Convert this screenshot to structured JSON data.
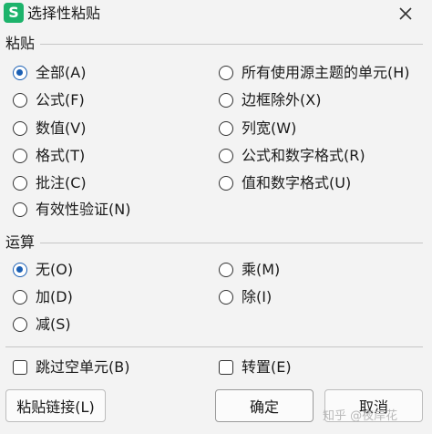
{
  "window": {
    "app_icon_letter": "S",
    "title": "选择性粘贴",
    "close_icon": "close-icon"
  },
  "paste": {
    "label": "粘贴",
    "options": [
      {
        "label": "全部(A)",
        "selected": true
      },
      {
        "label": "所有使用源主题的单元(H)",
        "selected": false
      },
      {
        "label": "公式(F)",
        "selected": false
      },
      {
        "label": "边框除外(X)",
        "selected": false
      },
      {
        "label": "数值(V)",
        "selected": false
      },
      {
        "label": "列宽(W)",
        "selected": false
      },
      {
        "label": "格式(T)",
        "selected": false
      },
      {
        "label": "公式和数字格式(R)",
        "selected": false
      },
      {
        "label": "批注(C)",
        "selected": false
      },
      {
        "label": "值和数字格式(U)",
        "selected": false
      },
      {
        "label": "有效性验证(N)",
        "selected": false
      }
    ]
  },
  "operation": {
    "label": "运算",
    "options": [
      {
        "label": "无(O)",
        "selected": true
      },
      {
        "label": "乘(M)",
        "selected": false
      },
      {
        "label": "加(D)",
        "selected": false
      },
      {
        "label": "除(I)",
        "selected": false
      },
      {
        "label": "减(S)",
        "selected": false
      }
    ]
  },
  "checkboxes": [
    {
      "label": "跳过空单元(B)",
      "checked": false
    },
    {
      "label": "转置(E)",
      "checked": false
    }
  ],
  "buttons": {
    "paste_link": "粘贴链接(L)",
    "ok": "确定",
    "cancel": "取消"
  },
  "watermark": "知乎 @夜岸花",
  "colors": {
    "accent": "#1a5fb4",
    "app_icon": "#1db36b",
    "background": "#f3f3f3"
  }
}
